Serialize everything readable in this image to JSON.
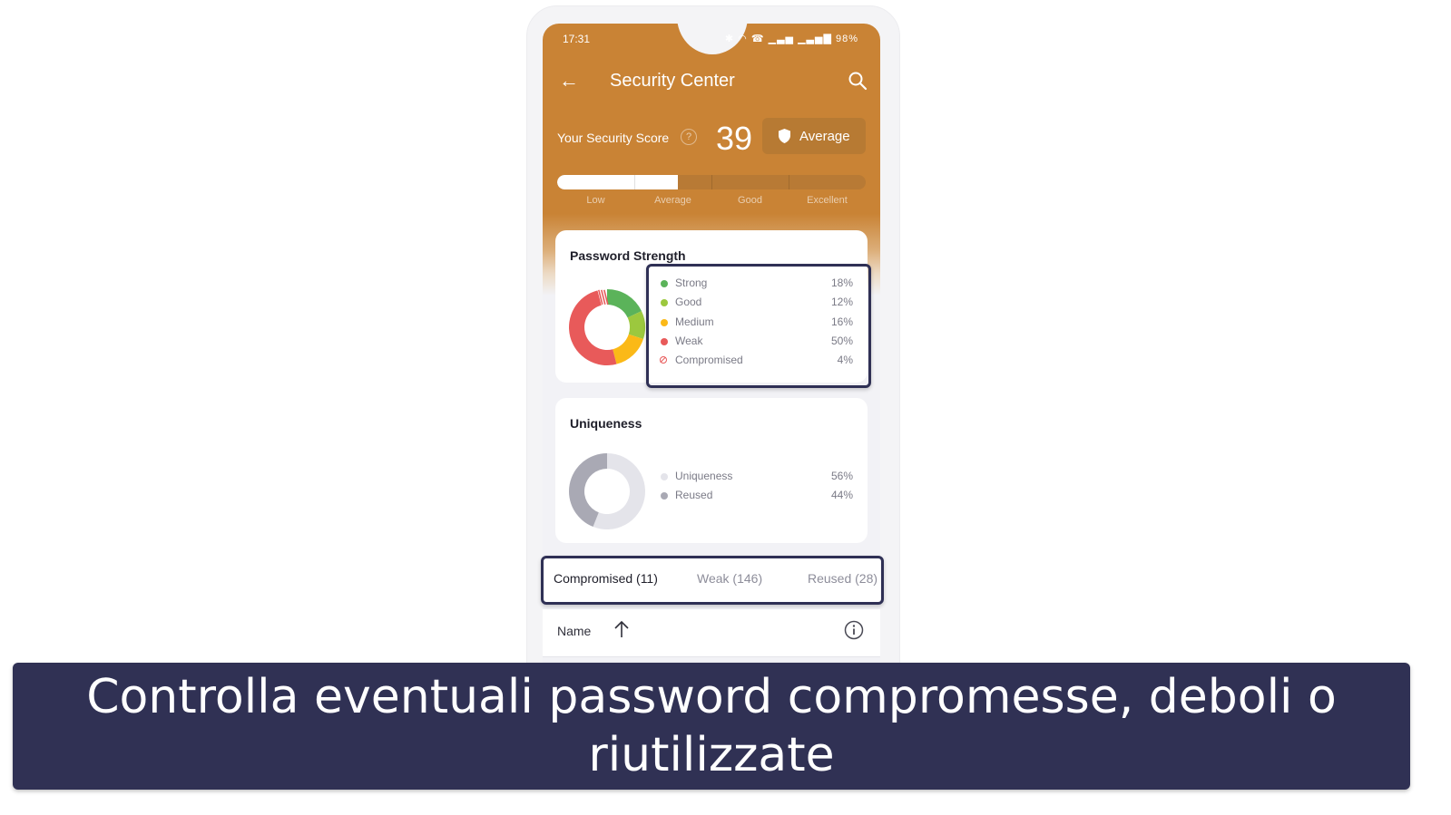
{
  "status_bar": {
    "time": "17:31",
    "icons": [
      "alarm-icon",
      "bluetooth-icon",
      "wifi-icon",
      "volte-icon",
      "signal-icon",
      "signal-icon"
    ],
    "battery": "98%"
  },
  "app_bar": {
    "title": "Security Center",
    "back_icon": "arrow-left-icon",
    "search_icon": "search-icon"
  },
  "score": {
    "label": "Your Security Score",
    "help_glyph": "?",
    "value": "39",
    "badge_label": "Average",
    "progress_percent": 39,
    "levels": [
      "Low",
      "Average",
      "Good",
      "Excellent"
    ]
  },
  "password_strength": {
    "title": "Password Strength",
    "items": [
      {
        "label": "Strong",
        "value": "18%",
        "percent": 18,
        "color": "#5bb35a"
      },
      {
        "label": "Good",
        "value": "12%",
        "percent": 12,
        "color": "#9cc83e"
      },
      {
        "label": "Medium",
        "value": "16%",
        "percent": 16,
        "color": "#fbb917"
      },
      {
        "label": "Weak",
        "value": "50%",
        "percent": 50,
        "color": "#e85a5a"
      },
      {
        "label": "Compromised",
        "value": "4%",
        "percent": 4,
        "color": "#e85a5a"
      }
    ]
  },
  "uniqueness": {
    "title": "Uniqueness",
    "items": [
      {
        "label": "Uniqueness",
        "value": "56%",
        "percent": 56,
        "color": "#e4e4ea"
      },
      {
        "label": "Reused",
        "value": "44%",
        "percent": 44,
        "color": "#a9a9b4"
      }
    ]
  },
  "tabs": [
    {
      "label": "Compromised (11)",
      "active": true
    },
    {
      "label": "Weak (146)",
      "active": false
    },
    {
      "label": "Reused (28)",
      "active": false
    }
  ],
  "list_header": {
    "name_label": "Name"
  },
  "caption": {
    "text": "Controlla eventuali password compromesse, deboli o riutilizzate"
  },
  "colors": {
    "brand_orange": "#c98335",
    "highlight_navy": "#2f3055",
    "caption_bg": "#303154"
  }
}
